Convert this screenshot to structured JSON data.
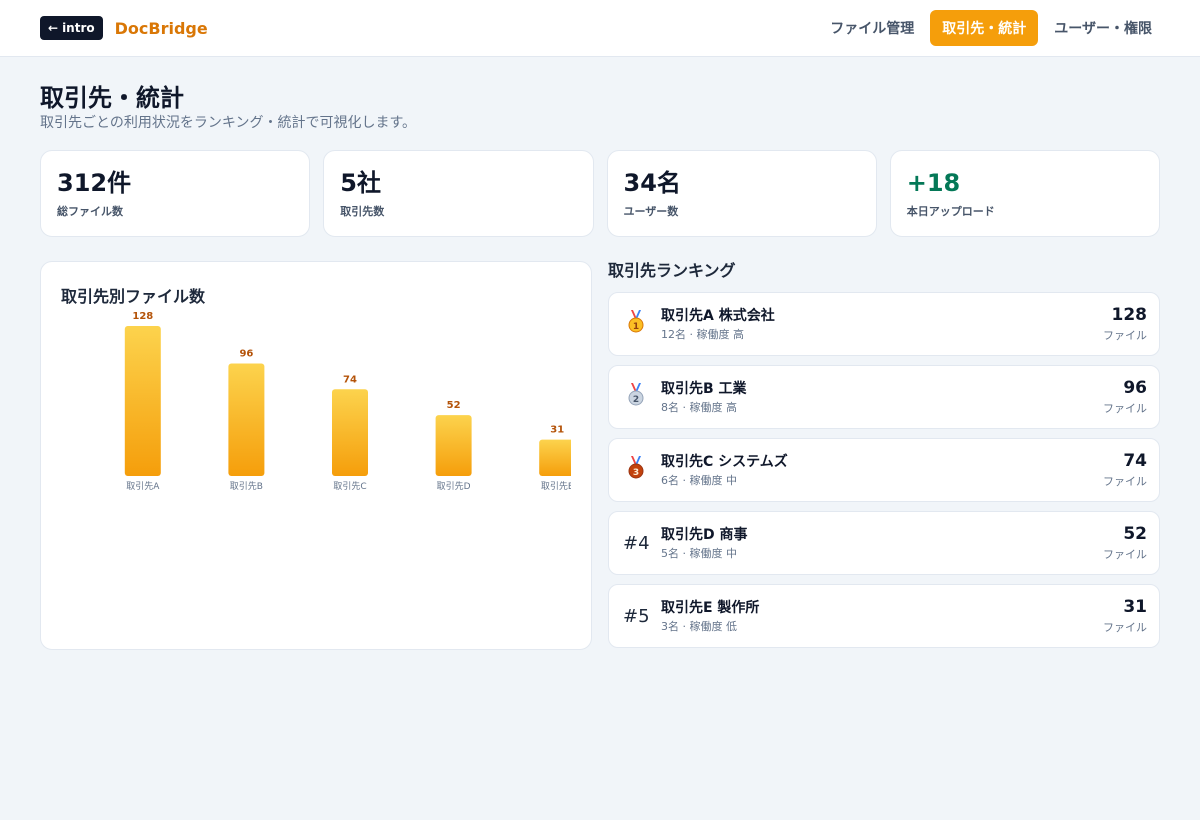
{
  "header": {
    "intro_label": "intro",
    "brand": "DocBridge",
    "nav": [
      {
        "label": "ファイル管理"
      },
      {
        "label": "取引先・統計"
      },
      {
        "label": "ユーザー・権限"
      }
    ]
  },
  "page": {
    "title": "取引先・統計",
    "subtitle": "取引先ごとの利用状況をランキング・統計で可視化します。"
  },
  "stats": [
    {
      "value": "312件",
      "label": "総ファイル数"
    },
    {
      "value": "5社",
      "label": "取引先数"
    },
    {
      "value": "34名",
      "label": "ユーザー数"
    },
    {
      "value": "+18",
      "label": "本日アップロード"
    }
  ],
  "chart_data": {
    "type": "bar",
    "title": "取引先別ファイル数",
    "categories": [
      "取引先A",
      "取引先B",
      "取引先C",
      "取引先D",
      "取引先E"
    ],
    "values": [
      128,
      96,
      74,
      52,
      31
    ],
    "value_labels": [
      "128",
      "96",
      "74",
      "52",
      "31"
    ],
    "bar_color_top": "#fcd34d",
    "bar_color_bottom": "#f59e0b",
    "label_color": "#b45309",
    "ylim": [
      0,
      128
    ],
    "grid": false
  },
  "ranking": {
    "title": "取引先ランキング",
    "items": [
      {
        "badge": "",
        "medal": "gold",
        "name": "取引先A 株式会社",
        "meta": "12名 · 稼働度 高",
        "count": "128",
        "unit": "ファイル"
      },
      {
        "badge": "",
        "medal": "silver",
        "name": "取引先B 工業",
        "meta": "8名 · 稼働度 高",
        "count": "96",
        "unit": "ファイル"
      },
      {
        "badge": "",
        "medal": "bronze",
        "name": "取引先C システムズ",
        "meta": "6名 · 稼働度 中",
        "count": "74",
        "unit": "ファイル"
      },
      {
        "badge": "#4",
        "medal": "",
        "name": "取引先D 商事",
        "meta": "5名 · 稼働度 中",
        "count": "52",
        "unit": "ファイル"
      },
      {
        "badge": "#5",
        "medal": "",
        "name": "取引先E 製作所",
        "meta": "3名 · 稼働度 低",
        "count": "31",
        "unit": "ファイル"
      }
    ]
  }
}
